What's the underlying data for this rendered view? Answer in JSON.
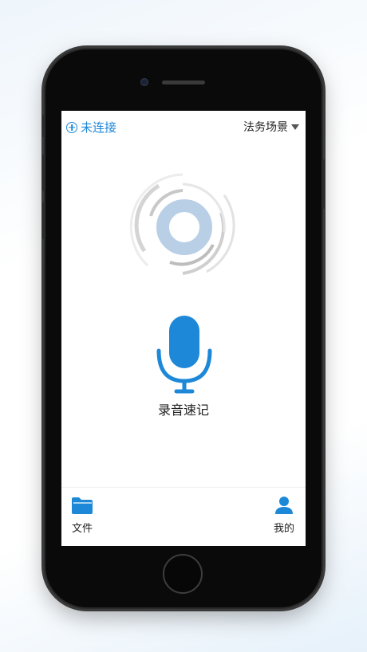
{
  "top_bar": {
    "connect_label": "未连接",
    "scene_label": "法务场景"
  },
  "main": {
    "record_label": "录音速记"
  },
  "tabbar": {
    "tabs": [
      {
        "label": "文件",
        "icon": "folder-icon"
      },
      {
        "label": "我的",
        "icon": "user-icon"
      }
    ]
  },
  "colors": {
    "accent": "#1e88d8",
    "ring": "#b9cfe6"
  }
}
